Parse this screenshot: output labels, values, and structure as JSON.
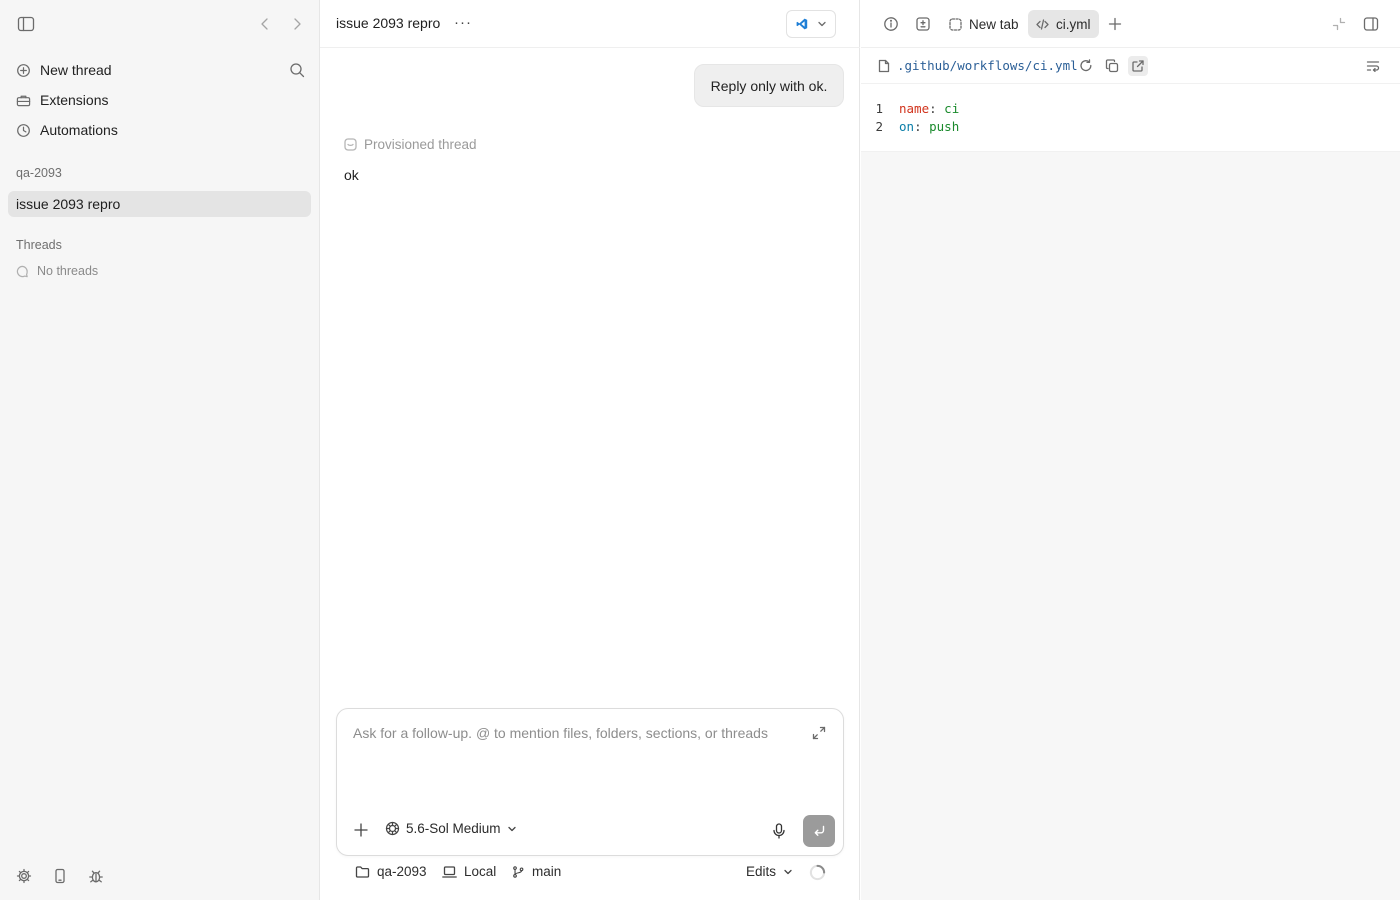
{
  "sidebar": {
    "nav": [
      {
        "label": "New thread",
        "icon": "plus-circle-icon"
      },
      {
        "label": "Extensions",
        "icon": "toolbox-icon"
      },
      {
        "label": "Automations",
        "icon": "clock-icon"
      }
    ],
    "project_label": "qa-2093",
    "active_thread": "issue 2093 repro",
    "threads_label": "Threads",
    "empty_threads": "No threads"
  },
  "chat": {
    "title": "issue 2093 repro",
    "more": "···",
    "user_message": "Reply only with ok.",
    "provisioned_label": "Provisioned thread",
    "assistant_reply": "ok",
    "composer": {
      "placeholder": "Ask for a follow-up. @ to mention files, folders, sections, or threads",
      "model": "5.6-Sol Medium"
    },
    "footer": {
      "folder": "qa-2093",
      "environment": "Local",
      "branch": "main",
      "edits": "Edits"
    }
  },
  "editor": {
    "tabs": [
      {
        "label": "New tab",
        "active": false
      },
      {
        "label": "ci.yml",
        "active": true
      }
    ],
    "file_path": ".github/workflows/ci.yml",
    "lines": [
      {
        "num": "1",
        "key": "name",
        "sep": ":",
        "value": "ci"
      },
      {
        "num": "2",
        "key": "on",
        "sep": ":",
        "value": "push"
      }
    ]
  },
  "colors": {
    "yaml_key_name": "#d1331c",
    "yaml_key_on": "#0a7ea8",
    "yaml_value": "#1a8a2c",
    "file_path": "#2b5f97"
  }
}
